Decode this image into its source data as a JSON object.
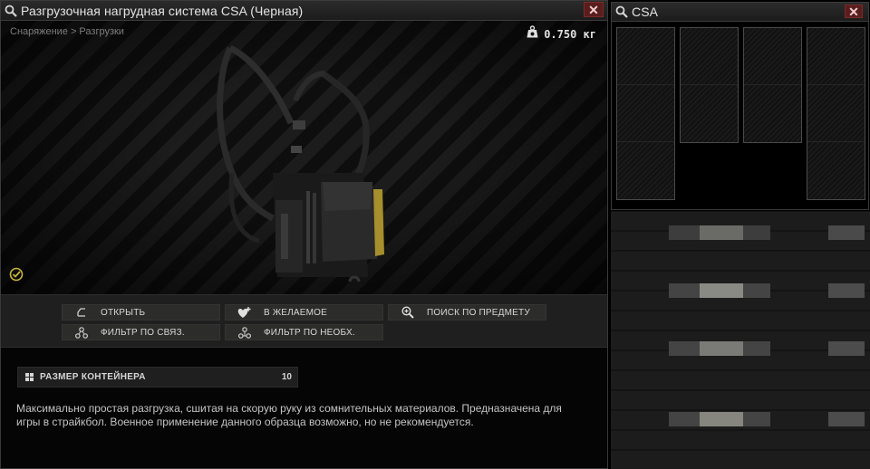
{
  "item_window": {
    "title": "Разгрузочная нагрудная система CSA (Черная)",
    "close_label": "✕",
    "breadcrumb": "Снаряжение > Разгрузки",
    "weight": "0.750 кг",
    "actions": [
      {
        "label": "ОТКРЫТЬ",
        "icon": "open-icon"
      },
      {
        "label": "В ЖЕЛАЕМОЕ",
        "icon": "wishlist-heart-icon"
      },
      {
        "label": "ПОИСК ПО ПРЕДМЕТУ",
        "icon": "search-item-icon"
      },
      {
        "label": "ФИЛЬТР ПО СВЯЗ.",
        "icon": "linked-filter-icon"
      },
      {
        "label": "ФИЛЬТР ПО НЕОБХ.",
        "icon": "required-filter-icon"
      }
    ],
    "stat": {
      "label": "РАЗМЕР КОНТЕЙНЕРА",
      "value": "10"
    },
    "description": "Максимально простая разгрузка, сшитая на скорую руку из сомнительных материалов. Предназначена для игры в страйкбол. Военное применение данного образца возможно, но не рекомендуется."
  },
  "container_window": {
    "title": "CSA",
    "close_label": "✕"
  },
  "colors": {
    "accent_yellow": "#c9b43c",
    "close_red": "#5a1d1d",
    "panel": "#1e1f1e"
  }
}
